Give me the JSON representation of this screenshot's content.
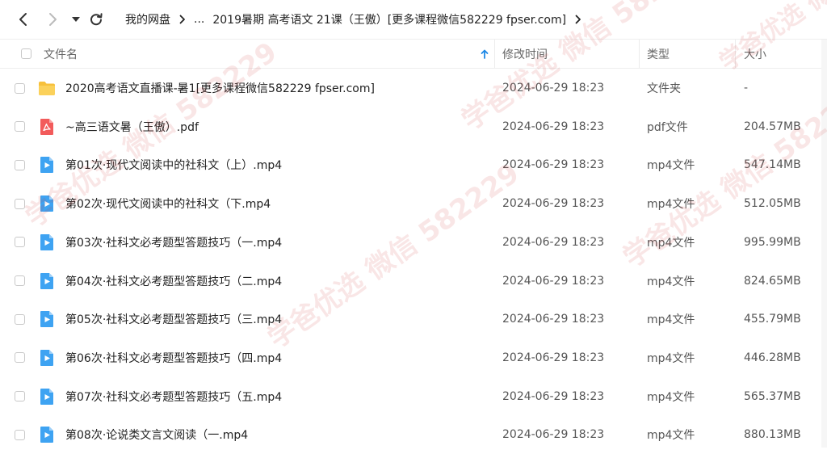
{
  "breadcrumb": {
    "items": [
      "我的网盘",
      "...",
      "2019暑期 高考语文 21课（王傲）[更多课程微信582229 fpser.com]"
    ]
  },
  "columns": {
    "name": "文件名",
    "modified": "修改时间",
    "type": "类型",
    "size": "大小"
  },
  "sort": {
    "column": "name",
    "direction": "ascending"
  },
  "colors": {
    "accent": "#1e88e5",
    "folder": "#f7c03b",
    "pdf": "#f25b5b",
    "video": "#3ea3f2"
  },
  "files": [
    {
      "icon": "folder-icon",
      "name": "2020高考语文直播课-暑1[更多课程微信582229 fpser.com]",
      "modified": "2024-06-29 18:23",
      "type": "文件夹",
      "size": "-"
    },
    {
      "icon": "pdf-icon",
      "name": "~高三语文暑（王傲）.pdf",
      "modified": "2024-06-29 18:23",
      "type": "pdf文件",
      "size": "204.57MB"
    },
    {
      "icon": "video-icon",
      "name": "第01次·现代文阅读中的社科文（上）.mp4",
      "modified": "2024-06-29 18:23",
      "type": "mp4文件",
      "size": "547.14MB"
    },
    {
      "icon": "video-icon",
      "name": "第02次·现代文阅读中的社科文（下.mp4",
      "modified": "2024-06-29 18:23",
      "type": "mp4文件",
      "size": "512.05MB"
    },
    {
      "icon": "video-icon",
      "name": "第03次·社科文必考题型答题技巧（一.mp4",
      "modified": "2024-06-29 18:23",
      "type": "mp4文件",
      "size": "995.99MB"
    },
    {
      "icon": "video-icon",
      "name": "第04次·社科文必考题型答题技巧（二.mp4",
      "modified": "2024-06-29 18:23",
      "type": "mp4文件",
      "size": "824.65MB"
    },
    {
      "icon": "video-icon",
      "name": "第05次·社科文必考题型答题技巧（三.mp4",
      "modified": "2024-06-29 18:23",
      "type": "mp4文件",
      "size": "455.79MB"
    },
    {
      "icon": "video-icon",
      "name": "第06次·社科文必考题型答题技巧（四.mp4",
      "modified": "2024-06-29 18:23",
      "type": "mp4文件",
      "size": "446.28MB"
    },
    {
      "icon": "video-icon",
      "name": "第07次·社科文必考题型答题技巧（五.mp4",
      "modified": "2024-06-29 18:23",
      "type": "mp4文件",
      "size": "565.37MB"
    },
    {
      "icon": "video-icon",
      "name": "第08次·论说类文言文阅读（一.mp4",
      "modified": "2024-06-29 18:23",
      "type": "mp4文件",
      "size": "880.13MB"
    }
  ],
  "watermark": {
    "text": "学爸优选 微信 582229"
  }
}
